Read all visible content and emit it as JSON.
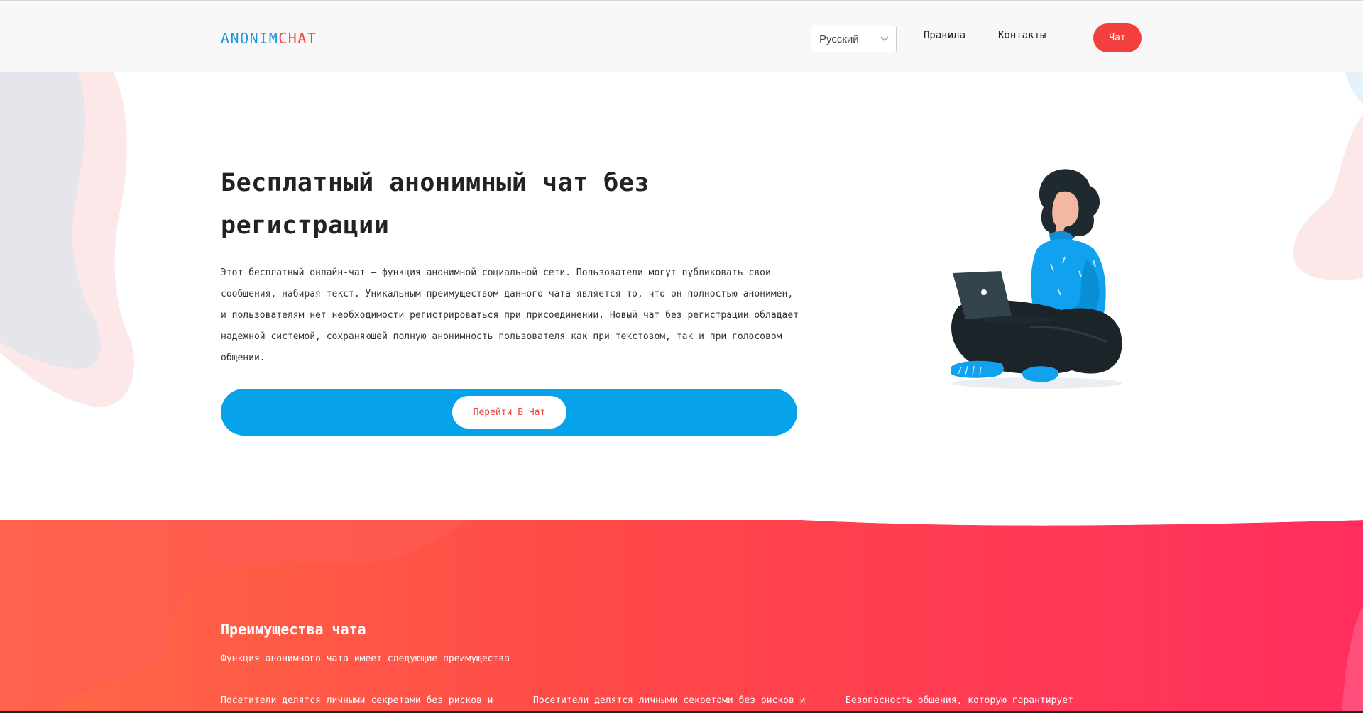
{
  "header": {
    "logo_part1": "ANONIM",
    "logo_part2": "CHAT",
    "language": {
      "selected": "Русский",
      "icon": "chevron-down-icon"
    },
    "nav": {
      "rules": "Правила",
      "contacts": "Контакты"
    },
    "chat_button": "Чат"
  },
  "hero": {
    "title": "Бесплатный анонимный чат без регистрации",
    "description": "Этот бесплатный онлайн-чат – функция анонимной социальной сети. Пользователи могут публиковать свои сообщения, набирая текст. Уникальным преимуществом данного чата является то, что он полностью анонимен, и пользователям нет необходимости регистрироваться при присоединении. Новый чат без регистрации обладает надежной системой, сохраняющей полную анонимность пользователя как при текстовом, так и при голосовом общении.",
    "cta": "Перейти В Чат"
  },
  "advantages": {
    "title": "Преимущества чата",
    "subtitle": "Функция анонимного чата имеет следующие преимущества",
    "items": [
      "Посетители делятся личными секретами без рисков и",
      "Посетители делятся личными секретами без рисков и",
      "Безопасность общения, которую гарантирует"
    ]
  },
  "colors": {
    "logo_blue": "#1a9be0",
    "logo_red": "#f2433f",
    "accent_red": "#f3403e",
    "hero_blue": "#06a3ea",
    "section_gradient_start": "#ff6a45",
    "section_gradient_end": "#ff2e5f"
  }
}
